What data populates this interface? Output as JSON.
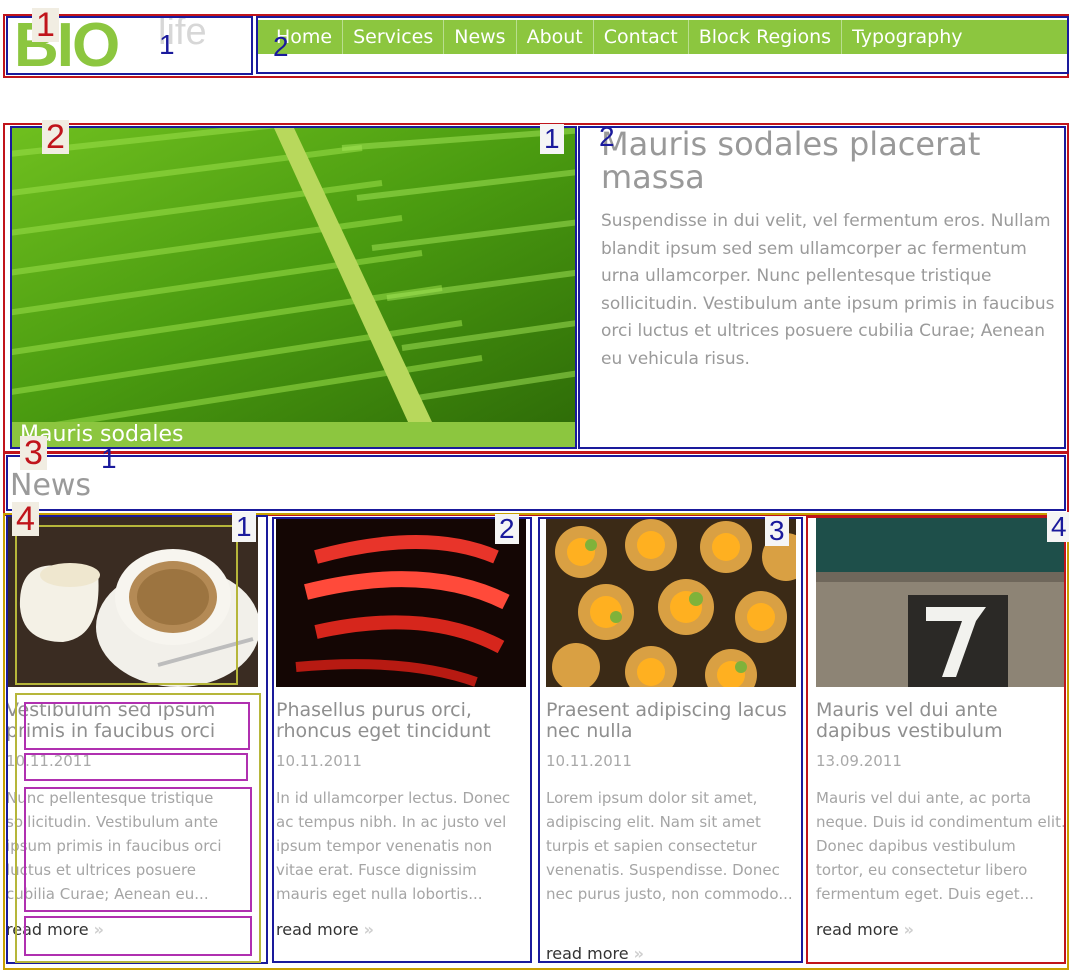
{
  "header": {
    "logo_main": "BIO",
    "logo_sub": "life",
    "nav": [
      "Home",
      "Services",
      "News",
      "About",
      "Contact",
      "Block Regions",
      "Typography"
    ]
  },
  "hero": {
    "caption": "Mauris sodales",
    "title": "Mauris sodales placerat massa",
    "text": "Suspendisse in dui velit, vel fermentum eros. Nullam blandit ipsum sed sem ullamcorper ac fermentum urna ullamcorper. Nunc pellentesque tristique sollicitudin. Vestibulum ante ipsum primis in faucibus orci luctus et ultrices posuere cubilia Curae; Aenean eu vehicula risus."
  },
  "news": {
    "heading": "News",
    "read_more": "read more",
    "cards": [
      {
        "title": "Vestibulum sed ipsum primis in faucibus orci",
        "date": "10.11.2011",
        "text": "Nunc pellentesque tristique sollicitudin. Vestibulum ante ipsum primis in faucibus orci luctus et ultrices posuere cubilia Curae; Aenean eu..."
      },
      {
        "title": "Phasellus purus orci, rhoncus eget tincidunt",
        "date": "10.11.2011",
        "text": "In id ullamcorper lectus. Donec ac tempus nibh. In ac justo vel ipsum tempor venenatis non vitae erat. Fusce dignissim mauris eget nulla lobortis..."
      },
      {
        "title": "Praesent adipiscing lacus nec nulla",
        "date": "10.11.2011",
        "text": "Lorem ipsum dolor sit amet, adipiscing elit. Nam sit amet turpis et sapien consectetur venenatis. Suspendisse. Donec nec purus justo, non commodo..."
      },
      {
        "title": "Mauris vel dui ante dapibus vestibulum",
        "date": "13.09.2011",
        "text": "Mauris vel dui ante, ac porta neque. Duis id condimentum elit. Donec dapibus vestibulum tortor, eu consectetur libero fermentum eget. Duis eget..."
      }
    ]
  },
  "annotations": {
    "red": [
      "1",
      "2",
      "3",
      "4"
    ],
    "blue": [
      "1",
      "2",
      "1",
      "2",
      "1",
      "1",
      "2",
      "3",
      "4"
    ]
  },
  "colors": {
    "accent": "#8cc63f",
    "annotation_red": "#c0141b",
    "annotation_blue": "#1a1a9c",
    "annotation_olive": "#b6b63a",
    "annotation_purple": "#b030b0"
  }
}
